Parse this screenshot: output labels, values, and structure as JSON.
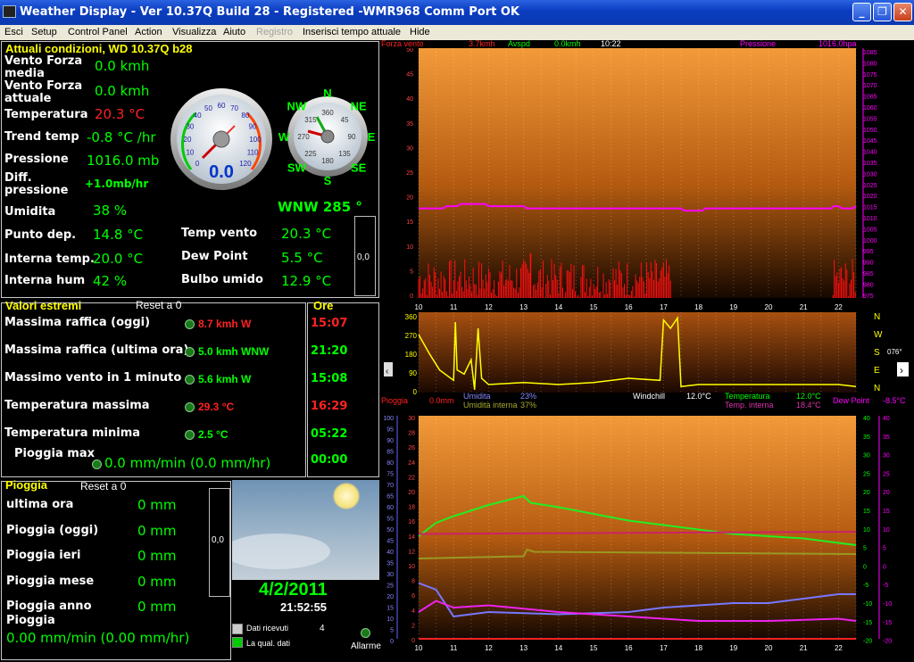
{
  "window": {
    "title": "Weather Display - Ver 10.37Q Build 28 - Registered   -WMR968 Comm Port OK"
  },
  "menu": [
    "Esci",
    "Setup",
    "Control Panel",
    "Action",
    "Visualizza",
    "Aiuto",
    "Registro",
    "Inserisci tempo attuale",
    "Hide"
  ],
  "current": {
    "header": "Attuali condizioni, WD 10.37Q b28",
    "wind_avg_label": "Vento Forza media",
    "wind_avg": "0.0 kmh",
    "wind_gust_label": "Vento Forza attuale",
    "wind_gust": "0.0 kmh",
    "temp_label": "Temperatura",
    "temp": "20.3 °C",
    "trend_label": "Trend temp",
    "trend": "-0.8 °C /hr",
    "pressure_label": "Pressione",
    "pressure": "1016.0 mb",
    "pdiff_label": "Diff. pressione",
    "pdiff": "+1.0mb/hr",
    "hum_label": "Umidita",
    "hum": "38 %",
    "dew_label": "Punto dep.",
    "dew": "14.8 °C",
    "intemp_label": "Interna temp.",
    "intemp": "20.0 °C",
    "inhum_label": "Interna hum",
    "inhum": "42 %",
    "windtemp_label": "Temp vento",
    "windtemp": "20.3 °C",
    "dewpoint_label": "Dew Point",
    "dewpoint": "5.5 °C",
    "wetbulb_label": "Bulbo umido",
    "wetbulb": "12.9 °C",
    "gauge_value": "0.0",
    "box_value": "0,0",
    "direction": "WNW  285 °"
  },
  "gauge": {
    "speed_ticks": [
      "0",
      "10",
      "20",
      "30",
      "40",
      "50",
      "60",
      "70",
      "80",
      "90",
      "100",
      "110",
      "120"
    ],
    "compass": [
      "N",
      "NE",
      "E",
      "SE",
      "S",
      "SW",
      "W",
      "NW"
    ],
    "compass_deg": [
      "360",
      "45",
      "90",
      "135",
      "180",
      "225",
      "270",
      "315"
    ]
  },
  "extremes": {
    "header": "Valori estremi",
    "reset": "Reset a 0",
    "time_header": "Ore",
    "rows": [
      {
        "label": "Massima raffica (oggi)",
        "value": "8.7 kmh W",
        "time": "15:07",
        "color": "#f22"
      },
      {
        "label": "Massima raffica (ultima ora)",
        "value": "5.0 kmh WNW",
        "time": "21:20",
        "color": "#0f0"
      },
      {
        "label": "Massimo vento in 1 minuto",
        "value": "5.6 kmh W",
        "time": "15:08",
        "color": "#0f0"
      },
      {
        "label": "Temperatura massima",
        "value": "29.3 °C",
        "time": "16:29",
        "color": "#f22"
      },
      {
        "label": "Temperatura minima",
        "value": "2.5 °C",
        "time": "05:22",
        "color": "#0f0"
      }
    ],
    "rain_label": "Pioggia max",
    "rain_value": "0.0 mm/min (0.0 mm/hr)",
    "rain_time": "00:00"
  },
  "rain": {
    "header": "Pioggia",
    "reset": "Reset a 0",
    "rows": [
      {
        "label": "ultima ora",
        "value": "0 mm"
      },
      {
        "label": "Pioggia (oggi)",
        "value": "0 mm"
      },
      {
        "label": "Pioggia ieri",
        "value": "0 mm"
      },
      {
        "label": "Pioggia mese",
        "value": "0 mm"
      },
      {
        "label": "Pioggia anno",
        "value": "0 mm"
      }
    ],
    "rate_label": "Pioggia",
    "rate": "0.00 mm/min (0.00 mm/hr)",
    "box_value": "0,0"
  },
  "date": "4/2/2011",
  "time": "21:52:55",
  "status": {
    "received": "Dati ricevuti",
    "quality": "La qual. dati",
    "count": "4",
    "alarm": "Allarme"
  },
  "chart_data": [
    {
      "type": "line",
      "title": "",
      "header": {
        "wind_label": "Forza vento",
        "wind": "3.7kmh",
        "avg_label": "Avspd",
        "avg": "0.0kmh",
        "time": "10:22",
        "pres_label": "Pressione",
        "pres": "1016.0hpa"
      },
      "x": [
        "10",
        "11",
        "12",
        "13",
        "14",
        "15",
        "16",
        "17",
        "18",
        "19",
        "20",
        "21",
        "22"
      ],
      "y_left": [
        "50",
        "45",
        "40",
        "35",
        "30",
        "25",
        "20",
        "15",
        "10",
        "5",
        "0"
      ],
      "y_right": [
        "1085",
        "1080",
        "1075",
        "1070",
        "1065",
        "1060",
        "1055",
        "1050",
        "1045",
        "1040",
        "1035",
        "1030",
        "1025",
        "1020",
        "1015",
        "1010",
        "1005",
        "1000",
        "995",
        "990",
        "985",
        "980",
        "975"
      ],
      "ylim_left": [
        0,
        50
      ],
      "ylim_right": [
        975,
        1085
      ],
      "series": [
        {
          "name": "Pressione",
          "color": "#ff00ff",
          "points": [
            [
              10,
              1015
            ],
            [
              10.7,
              1015
            ],
            [
              10.8,
              1016
            ],
            [
              11.1,
              1016
            ],
            [
              11.2,
              1017
            ],
            [
              11.9,
              1017
            ],
            [
              12,
              1016
            ],
            [
              13,
              1016
            ],
            [
              13.1,
              1015
            ],
            [
              17.5,
              1015
            ],
            [
              17.6,
              1014
            ],
            [
              18.1,
              1014
            ],
            [
              18.2,
              1015
            ],
            [
              21.8,
              1015
            ],
            [
              21.85,
              1016
            ],
            [
              22,
              1016
            ],
            [
              22.1,
              1015
            ],
            [
              22.4,
              1015
            ],
            [
              22.5,
              1016
            ]
          ]
        }
      ]
    },
    {
      "type": "line",
      "title": "",
      "y_left": [
        "360",
        "270",
        "180",
        "90",
        "0"
      ],
      "right_labels": [
        "N",
        "W",
        "S",
        "E",
        "N"
      ],
      "right_value": "076°",
      "series": [
        {
          "name": "",
          "color": "#ffff00",
          "points": [
            [
              10,
              270
            ],
            [
              10.3,
              180
            ],
            [
              10.6,
              100
            ],
            [
              11,
              50
            ],
            [
              11.05,
              330
            ],
            [
              11.1,
              100
            ],
            [
              11.3,
              80
            ],
            [
              11.5,
              150
            ],
            [
              11.6,
              5
            ],
            [
              11.7,
              300
            ],
            [
              11.8,
              60
            ],
            [
              12,
              30
            ],
            [
              13,
              40
            ],
            [
              14,
              30
            ],
            [
              15,
              40
            ],
            [
              16,
              60
            ],
            [
              16.9,
              50
            ],
            [
              17,
              340
            ],
            [
              17.2,
              300
            ],
            [
              17.4,
              350
            ],
            [
              17.5,
              20
            ],
            [
              18,
              30
            ],
            [
              20,
              30
            ],
            [
              22,
              30
            ],
            [
              22.5,
              20
            ]
          ]
        }
      ]
    },
    {
      "type": "line",
      "title": "",
      "header": {
        "rain_label": "Pioggia",
        "rain": "0.0mm",
        "hum_label": "Umidita",
        "hum": "23%",
        "inhum_label": "Umidità interna",
        "inhum": "37%",
        "wc_label": "Windchill",
        "wc": "12.0°C",
        "temp_label": "Temperatura",
        "temp": "12.0°C",
        "intemp_label": "Temp. interna",
        "intemp": "18.4°C",
        "dew_label": "Dew Point",
        "dew": "-8.5°C"
      },
      "x": [
        "10",
        "11",
        "12",
        "13",
        "14",
        "15",
        "16",
        "17",
        "18",
        "19",
        "20",
        "21",
        "22"
      ],
      "y_hum": [
        "100",
        "95",
        "90",
        "85",
        "80",
        "75",
        "70",
        "65",
        "60",
        "55",
        "50",
        "45",
        "40",
        "35",
        "30",
        "25",
        "20",
        "15",
        "10",
        "5",
        "0"
      ],
      "y_left2": [
        "30",
        "28",
        "26",
        "24",
        "22",
        "20",
        "18",
        "16",
        "14",
        "12",
        "10",
        "8",
        "6",
        "4",
        "2",
        "0"
      ],
      "y_right1": [
        "40",
        "35",
        "30",
        "25",
        "20",
        "15",
        "10",
        "5",
        "0",
        "-5",
        "-10",
        "-15",
        "-20"
      ],
      "y_right2": [
        "40",
        "35",
        "30",
        "25",
        "20",
        "15",
        "10",
        "5",
        "0",
        "-5",
        "-10",
        "-15",
        "-20"
      ],
      "series": [
        {
          "name": "Temperatura",
          "color": "#22ee22",
          "points": [
            [
              10,
              46
            ],
            [
              10.5,
              52
            ],
            [
              11,
              55
            ],
            [
              12,
              60
            ],
            [
              13,
              64
            ],
            [
              13.2,
              61
            ],
            [
              14,
              59
            ],
            [
              15,
              56
            ],
            [
              16,
              53
            ],
            [
              17,
              51
            ],
            [
              18,
              49
            ],
            [
              19,
              47
            ],
            [
              20,
              46
            ],
            [
              21,
              45
            ],
            [
              22,
              43
            ],
            [
              22.5,
              42
            ]
          ]
        },
        {
          "name": "Temp. interna",
          "color": "#cc2266",
          "points": [
            [
              10,
              47
            ],
            [
              22.5,
              48
            ]
          ]
        },
        {
          "name": "Umidità interna",
          "color": "#999922",
          "points": [
            [
              10,
              36
            ],
            [
              13,
              37
            ],
            [
              13.1,
              40
            ],
            [
              13.3,
              39
            ],
            [
              22.5,
              38
            ]
          ]
        },
        {
          "name": "Umidita",
          "color": "#7777ff",
          "points": [
            [
              10,
              25
            ],
            [
              10.5,
              22
            ],
            [
              11,
              10
            ],
            [
              12,
              12
            ],
            [
              14,
              11
            ],
            [
              16,
              12
            ],
            [
              17,
              14
            ],
            [
              18,
              15
            ],
            [
              19,
              16
            ],
            [
              20,
              16
            ],
            [
              21,
              18
            ],
            [
              22,
              20
            ],
            [
              22.5,
              20
            ]
          ]
        },
        {
          "name": "Dew Point",
          "color": "#ee22ee",
          "points": [
            [
              10,
              12
            ],
            [
              10.5,
              17
            ],
            [
              11,
              14
            ],
            [
              12,
              15
            ],
            [
              14,
              12
            ],
            [
              16,
              10
            ],
            [
              18,
              8
            ],
            [
              20,
              8
            ],
            [
              22,
              9
            ],
            [
              22.5,
              8
            ]
          ]
        },
        {
          "name": "Pioggia",
          "color": "#ff2222",
          "points": [
            [
              10,
              0
            ],
            [
              22.5,
              0
            ]
          ]
        }
      ]
    }
  ]
}
